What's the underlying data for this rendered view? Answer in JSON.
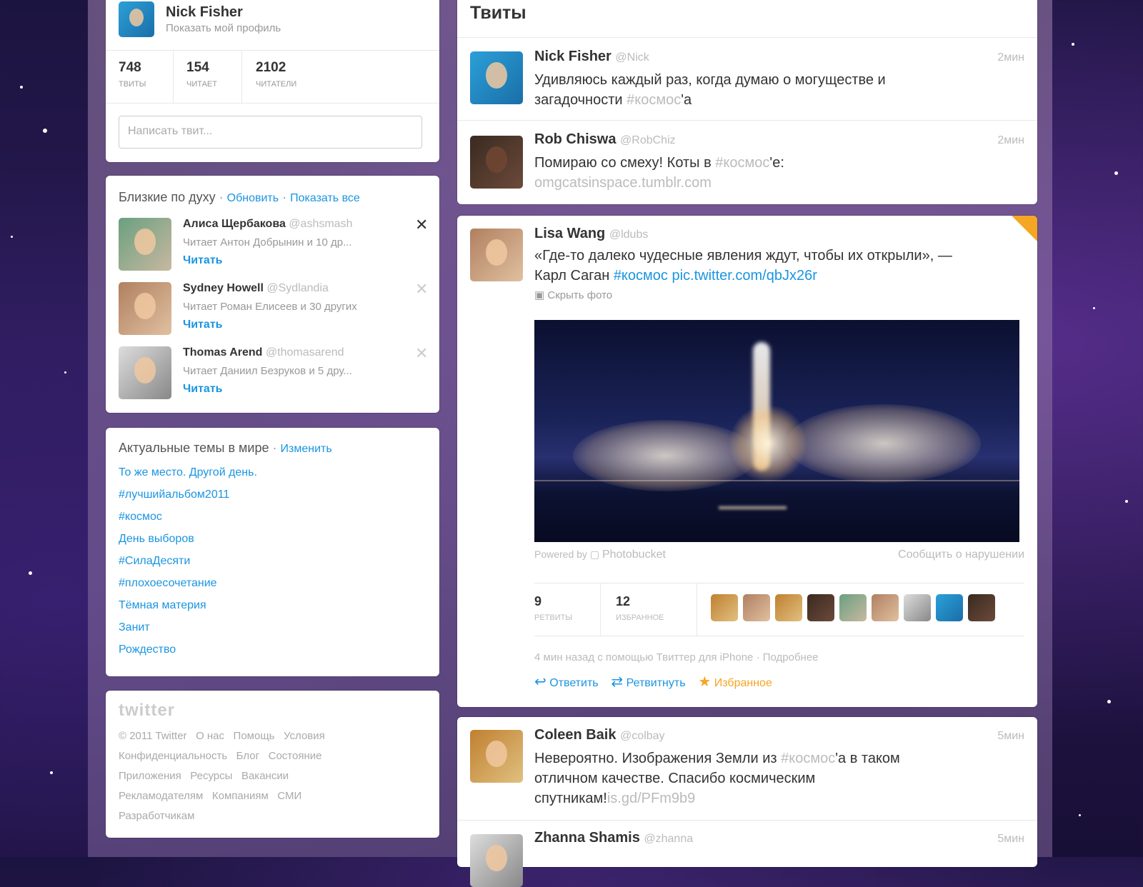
{
  "profile": {
    "name": "Nick Fisher",
    "show_profile": "Показать мой профиль",
    "stats": [
      {
        "value": "748",
        "label": "ТВИТЫ"
      },
      {
        "value": "154",
        "label": "ЧИТАЕТ"
      },
      {
        "value": "2102",
        "label": "ЧИТАТЕЛИ"
      }
    ],
    "compose_placeholder": "Написать твит..."
  },
  "suggestions": {
    "title": "Близкие по духу",
    "refresh": "Обновить",
    "show_all": "Показать все",
    "users": [
      {
        "name": "Алиса Щербакова",
        "handle": "@ashsmash",
        "followed_by": "Читает Антон Добрынин и 10 др...",
        "follow": "Читать"
      },
      {
        "name": "Sydney Howell",
        "handle": "@Sydlandia",
        "followed_by": "Читает Роман Елисеев и 30 других",
        "follow": "Читать"
      },
      {
        "name": "Thomas Arend",
        "handle": "@thomasarend",
        "followed_by": "Читает Даниил Безруков и 5 дру...",
        "follow": "Читать"
      }
    ]
  },
  "trends": {
    "title": "Актуальные темы в мире",
    "change": "Изменить",
    "items": [
      "То же место. Другой день.",
      "#лучшийальбом2011",
      "#космос",
      "День выборов",
      "#СилаДесяти",
      "#плохоесочетание",
      "Тёмная материя",
      "Занит",
      "Рождество"
    ]
  },
  "footer": {
    "logo": "twitter",
    "links": [
      "© 2011 Twitter",
      "О нас",
      "Помощь",
      "Условия",
      "Конфиденциальность",
      "Блог",
      "Состояние",
      "Приложения",
      "Ресурсы",
      "Вакансии",
      "Рекламодателям",
      "Компаниям",
      "СМИ",
      "Разработчикам"
    ]
  },
  "timeline": {
    "title": "Твиты",
    "tweets": [
      {
        "name": "Nick Fisher",
        "handle": "@Nick",
        "time": "2мин",
        "text_a": "Удивляюсь каждый раз, когда думаю о могуществе и",
        "text_b": "загадочности ",
        "hashtag": "#космос",
        "text_c": "'а"
      },
      {
        "name": "Rob Chiswa",
        "handle": "@RobChiz",
        "time": "2мин",
        "text_a": "Помираю со смеху! Коты в ",
        "hashtag": "#космос",
        "text_c": "'е:",
        "url": "omgcatsinspace.tumblr.com"
      }
    ],
    "expanded": {
      "name": "Lisa Wang",
      "handle": "@ldubs",
      "line1": "«Где-то далеко чудесные явления ждут, чтобы их открыли», —",
      "line2a": "Карл Саган ",
      "hashtag": "#космос",
      "pic": "pic.twitter.com/qbJx26r",
      "hide_photo": "Скрыть фото",
      "powered_by": "Powered by",
      "provider": "Photobucket",
      "report": "Сообщить о нарушении",
      "retweets": {
        "value": "9",
        "label": "РЕТВИТЫ"
      },
      "favorites": {
        "value": "12",
        "label": "ИЗБРАННОЕ"
      },
      "meta": "4 мин назад с помощью Твиттер для iPhone · Подробнее",
      "reply": "Ответить",
      "retweet": "Ретвитнуть",
      "favorite": "Избранное"
    },
    "tweet4": {
      "name": "Coleen Baik",
      "handle": "@colbay",
      "time": "5мин",
      "line1a": "Невероятно. Изображения Земли из ",
      "hashtag": "#космос",
      "line1b": "'а в таком",
      "line2": "отличном качестве. Спасибо космическим",
      "line3a": "спутникам!",
      "url": "is.gd/PFm9b9"
    },
    "tweet5": {
      "name": "Zhanna Shamis",
      "handle": "@zhanna",
      "time": "5мин"
    }
  },
  "colors": {
    "link": "#1b95e0",
    "favorite": "#f5a623"
  }
}
